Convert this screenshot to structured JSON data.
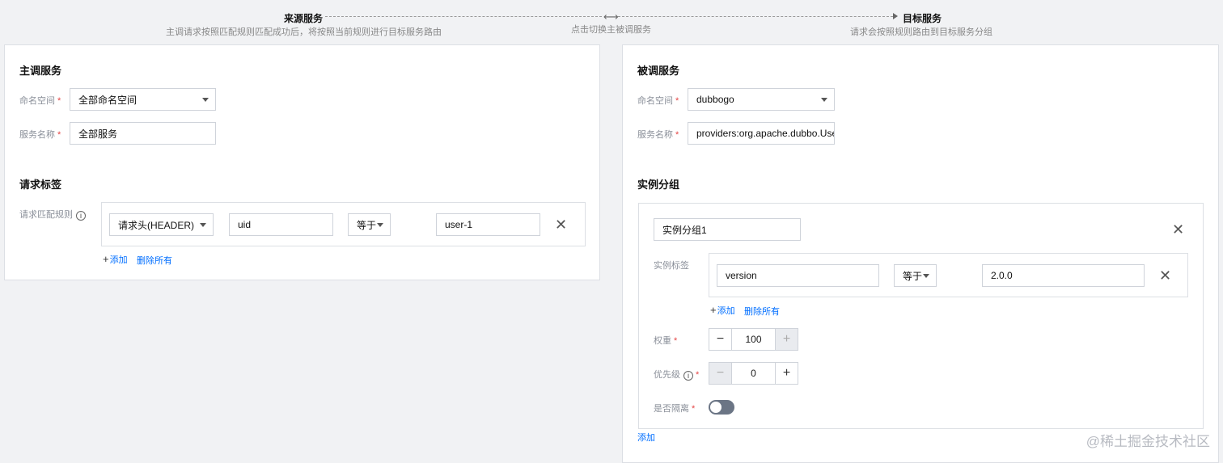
{
  "flow": {
    "source_title": "来源服务",
    "source_desc": "主调请求按照匹配规则匹配成功后，将按照当前规则进行目标服务路由",
    "swap_icon": "swap-arrows-icon",
    "swap_desc": "点击切换主被调服务",
    "target_title": "目标服务",
    "target_desc": "请求会按照规则路由到目标服务分组"
  },
  "left": {
    "title": "主调服务",
    "namespace_label": "命名空间",
    "namespace_value": "全部命名空间",
    "service_label": "服务名称",
    "service_value": "全部服务",
    "tags_title": "请求标签",
    "rule_label": "请求匹配规则",
    "rule": {
      "type": "请求头(HEADER)",
      "key": "uid",
      "op": "等于",
      "value": "user-1"
    },
    "add": "添加",
    "delete_all": "删除所有"
  },
  "right": {
    "title": "被调服务",
    "namespace_label": "命名空间",
    "namespace_value": "dubbogo",
    "service_label": "服务名称",
    "service_value": "providers:org.apache.dubbo.User",
    "group_title": "实例分组",
    "group": {
      "name": "实例分组1",
      "tag_label": "实例标签",
      "tag": {
        "key": "version",
        "op": "等于",
        "value": "2.0.0"
      },
      "add": "添加",
      "delete_all": "删除所有",
      "weight_label": "权重",
      "weight_value": "100",
      "priority_label": "优先级",
      "priority_value": "0",
      "isolate_label": "是否隔离",
      "isolate_on": false
    },
    "add_group": "添加"
  },
  "required_mark": "*",
  "info_glyph": "i",
  "close_glyph": "✕",
  "minus_glyph": "−",
  "plus_glyph": "+",
  "watermark": "@稀土掘金技术社区",
  "colors": {
    "link": "#006eff",
    "required": "#e54545",
    "toggle_off": "#6b7585"
  }
}
